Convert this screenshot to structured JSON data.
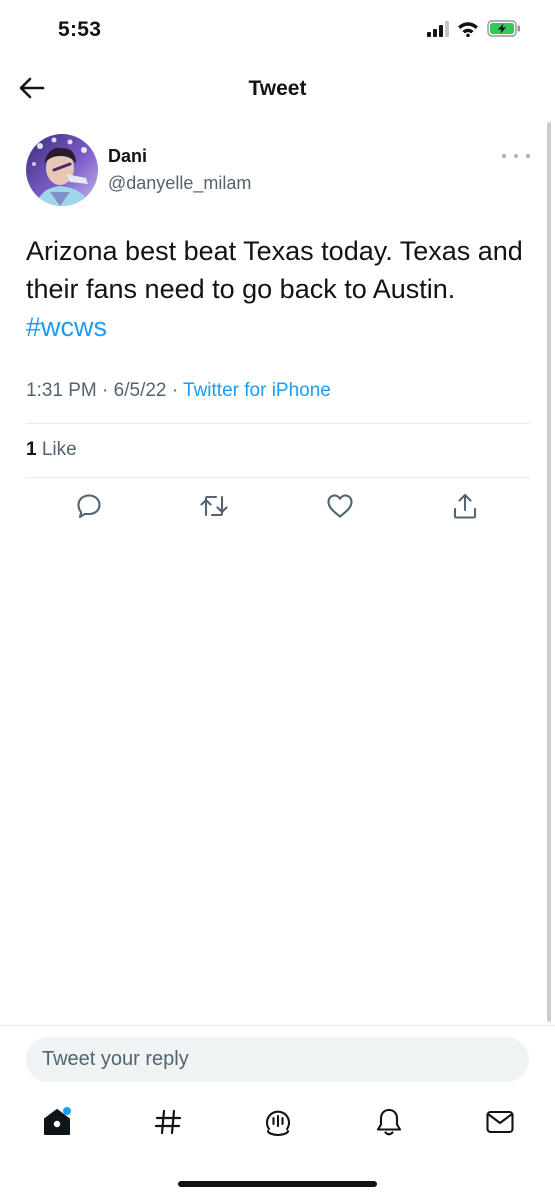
{
  "status_bar": {
    "time": "5:53",
    "icons": [
      "cellular-signal-icon",
      "wifi-icon",
      "battery-charging-icon"
    ],
    "battery_color": "#34c759"
  },
  "header": {
    "title": "Tweet",
    "back_icon": "back-arrow-icon"
  },
  "tweet": {
    "author_name": "Dani",
    "author_handle": "@danyelle_milam",
    "text": "Arizona best beat Texas today. Texas and their fans need to go back to Austin.",
    "hashtag": "#wcws",
    "time": "1:31 PM",
    "date": "6/5/22",
    "source": "Twitter for iPhone",
    "like_count": "1",
    "like_label": "Like"
  },
  "actions": [
    "reply-icon",
    "retweet-icon",
    "like-icon",
    "share-icon"
  ],
  "reply": {
    "placeholder": "Tweet your reply"
  },
  "tabbar": [
    "home-icon",
    "explore-hashtag-icon",
    "spaces-icon",
    "notifications-bell-icon",
    "messages-envelope-icon"
  ],
  "colors": {
    "accent": "#1d9bf0",
    "text": "#0f1419",
    "secondary": "#536471",
    "divider": "#e6ecf0"
  }
}
